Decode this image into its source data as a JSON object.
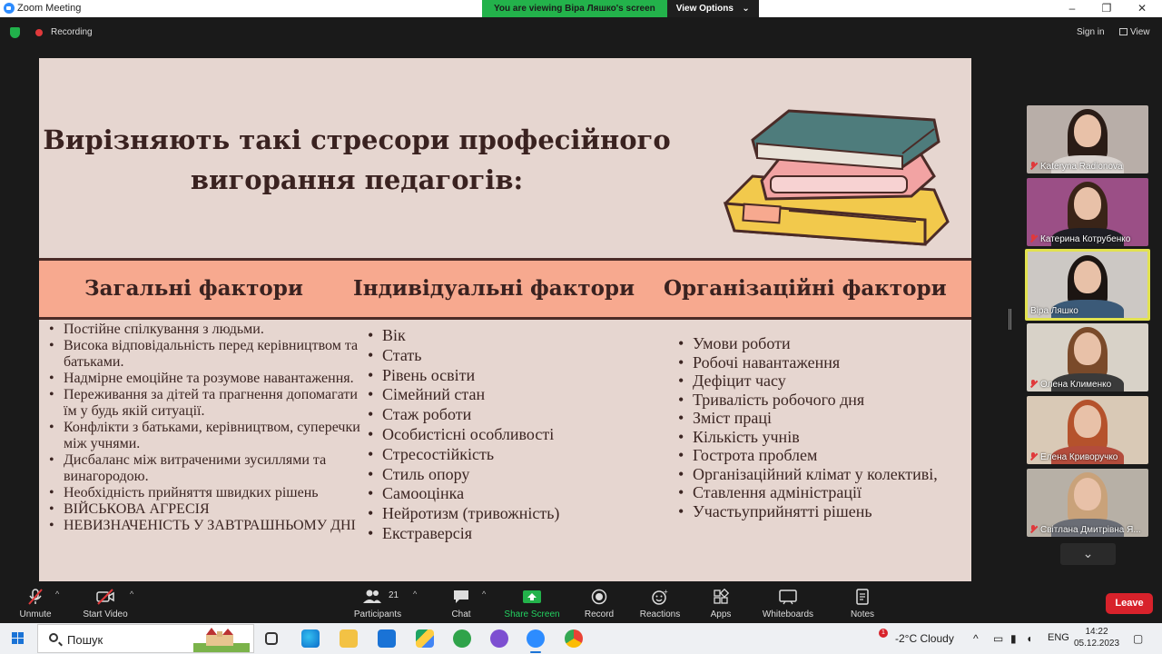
{
  "window": {
    "title": "Zoom Meeting",
    "viewing_banner": "You are viewing Віра Ляшко's screen",
    "view_options": "View Options"
  },
  "topbar": {
    "recording": "Recording",
    "sign_in": "Sign in",
    "view": "View"
  },
  "slide": {
    "title_line1": "Вирізняють такі стресори професійного",
    "title_line2": "вигорання педагогів:",
    "columns": [
      {
        "heading": "Загальні фактори",
        "items": [
          "Постійне спілкування з людьми.",
          "Висока відповідальність перед керівництвом та батьками.",
          "Надмірне емоційне та розумове навантаження.",
          "Переживання за дітей та прагнення допомагати їм у будь якій ситуації.",
          "Конфлікти з батьками, керівництвом, суперечки між учнями.",
          "Дисбаланс між витраченими зусиллями та винагородою.",
          "Необхідність прийняття швидких рішень",
          "ВІЙСЬКОВА АГРЕСІЯ",
          "НЕВИЗНАЧЕНІСТЬ У ЗАВТРАШНЬОМУ ДНІ"
        ]
      },
      {
        "heading": "Індивідуальні фактори",
        "items": [
          "Вік",
          "Стать",
          "Рівень освіти",
          "Сімейний стан",
          "Стаж роботи",
          "Особистісні особливості",
          "Стресостійкість",
          "Стиль опору",
          "Самооцінка",
          "Нейротизм (тривожність)",
          "Екстраверсія"
        ]
      },
      {
        "heading": "Організаційні фактори",
        "items": [
          "Умови роботи",
          "Робочі навантаження",
          "Дефіцит часу",
          "Тривалість робочого дня",
          "Зміст праці",
          "Кількість учнів",
          "Гострота проблем",
          "Організаційний клімат у колективі,",
          "Ставлення адміністрації",
          "Участьуприйнятті рішень"
        ]
      }
    ]
  },
  "participants_panel": [
    {
      "name": "Kateryna Radionova",
      "muted": true,
      "active": false,
      "bg": "#b8aea8",
      "hair": "#2a1c16",
      "shirt": "#d9d3cf"
    },
    {
      "name": "Катерина Котрубенко",
      "muted": true,
      "active": false,
      "bg": "#9b4f86",
      "hair": "#3a2418",
      "shirt": "#1e1e24"
    },
    {
      "name": "Віра Ляшко",
      "muted": false,
      "active": true,
      "bg": "#ccc8c4",
      "hair": "#1c1512",
      "shirt": "#3b5a78"
    },
    {
      "name": "Олена Клименко",
      "muted": true,
      "active": false,
      "bg": "#d8d2c8",
      "hair": "#7a4a2a",
      "shirt": "#3a3a3a"
    },
    {
      "name": "Елена Криворучко",
      "muted": true,
      "active": false,
      "bg": "#d9c9b6",
      "hair": "#b5522c",
      "shirt": "#b34c3c"
    },
    {
      "name": "Світлана Дмитрівна Я...",
      "muted": true,
      "active": false,
      "bg": "#b7b0a6",
      "hair": "#c9a27a",
      "shirt": "#6a6d75"
    }
  ],
  "toolbar": {
    "unmute": "Unmute",
    "start_video": "Start Video",
    "participants": "Participants",
    "participants_count": "21",
    "chat": "Chat",
    "share_screen": "Share Screen",
    "record": "Record",
    "reactions": "Reactions",
    "apps": "Apps",
    "whiteboards": "Whiteboards",
    "notes": "Notes",
    "leave": "Leave"
  },
  "taskbar": {
    "search_placeholder": "Пошук",
    "weather_badge": "1",
    "weather": "-2°C  Cloudy",
    "language": "ENG",
    "time": "14:22",
    "date": "05.12.2023"
  },
  "colors": {
    "slide_bg": "#e6d6d0",
    "band": "#f7a98f",
    "text_dark": "#3a2220",
    "zoom_green": "#23b24b",
    "leave_red": "#d8222b",
    "active_speaker": "#e2e24f"
  }
}
